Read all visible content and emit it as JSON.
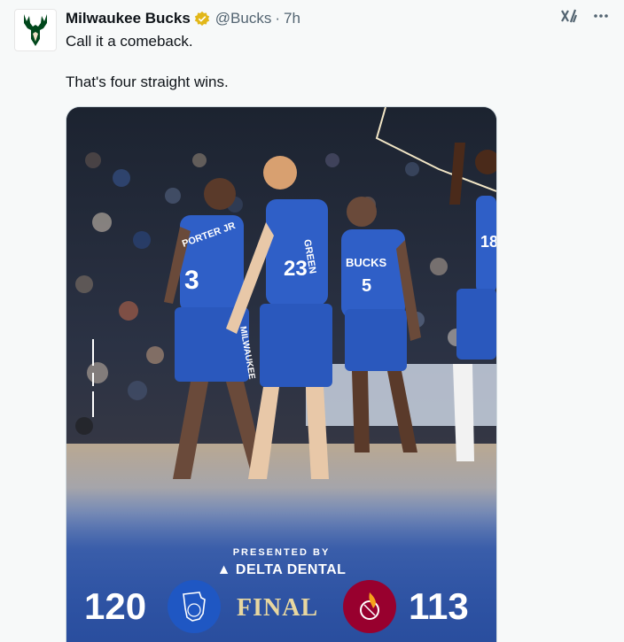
{
  "tweet": {
    "author_name": "Milwaukee Bucks",
    "handle": "@Bucks",
    "separator": "·",
    "time": "7h",
    "lines": [
      "Call it a comeback.",
      "That's four straight wins."
    ]
  },
  "media": {
    "presented_by": "PRESENTED BY",
    "sponsor": "DELTA DENTAL",
    "home_score": "120",
    "away_score": "113",
    "status": "FINAL",
    "jerseys": [
      "3",
      "23",
      "5",
      "18"
    ],
    "jersey_text": [
      "PORTER JR",
      "GREEN",
      "BUCKS",
      "MILWAUKEE"
    ]
  },
  "colors": {
    "bucks_green": "#00471b",
    "bucks_blue": "#1f57c3",
    "heat_red": "#98002e",
    "final_gold": "#e8d7a0",
    "verified_gold": "#e2b719"
  },
  "icons": {
    "avatar": "bucks-deer-logo",
    "verified": "verified-badge-icon",
    "grok": "grok-icon",
    "more": "more-options-icon"
  }
}
